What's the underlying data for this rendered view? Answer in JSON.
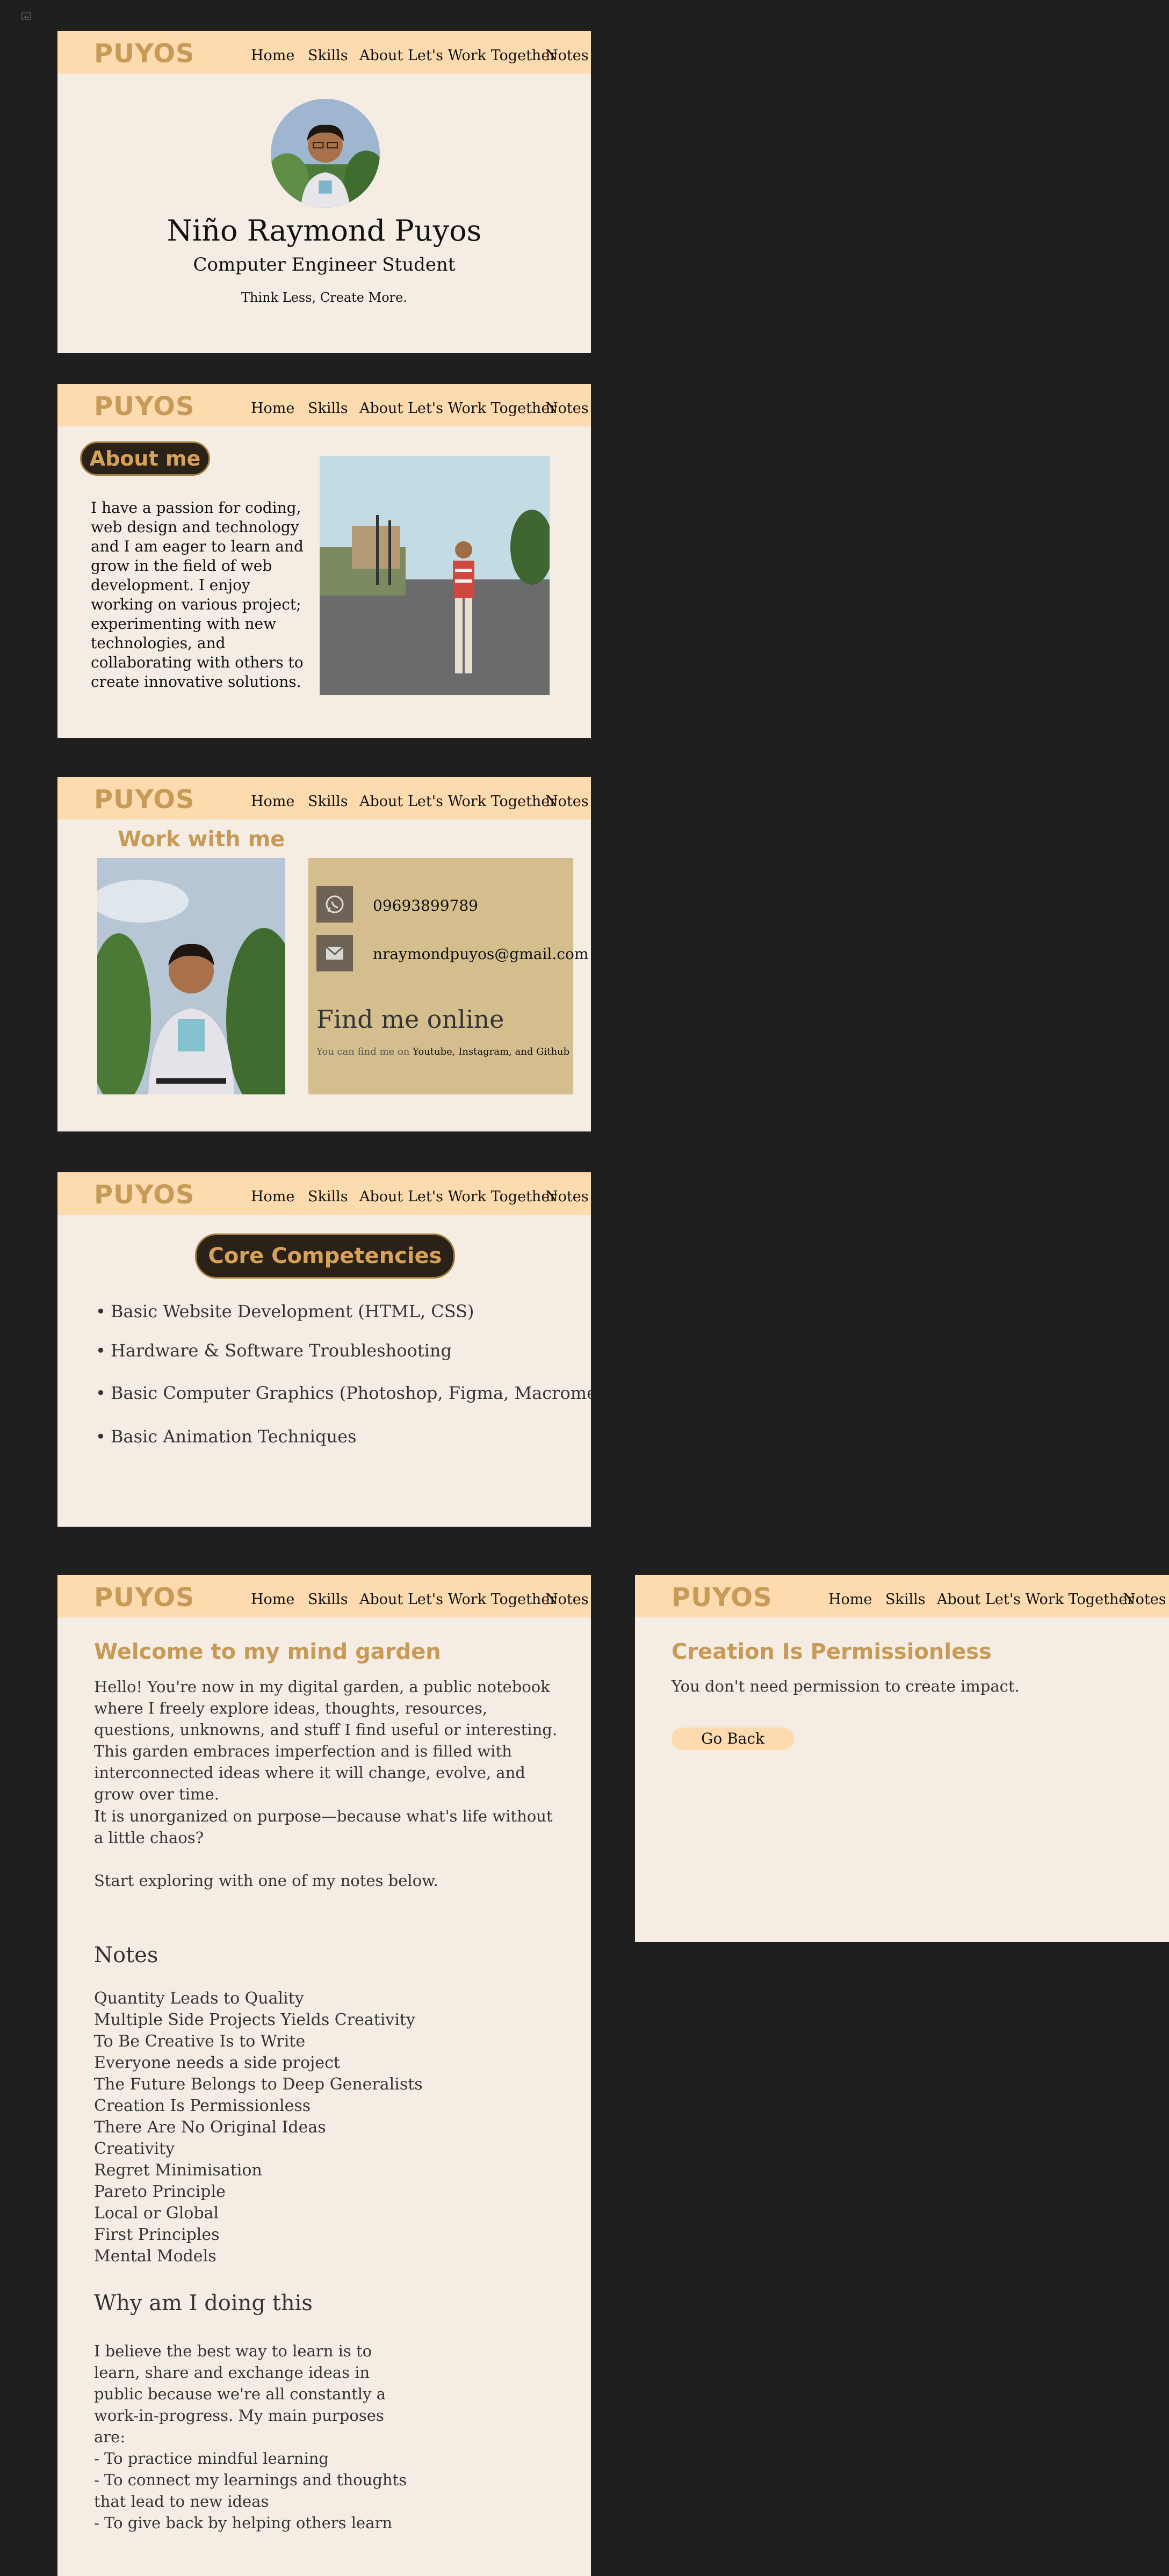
{
  "nav": {
    "logo": "PUYOS",
    "links": [
      "Home",
      "Skills",
      "About",
      "Let's Work Together",
      "Notes"
    ]
  },
  "home": {
    "name": "Niño Raymond Puyos",
    "role": "Computer Engineer Student",
    "tagline": "Think Less, Create More."
  },
  "about": {
    "badge": "About me",
    "text": "I have a passion for coding, web design and technology and I am eager to learn and grow in the field of web development. I enjoy working on various project; experimenting with new technologies, and collaborating with others to create innovative solutions."
  },
  "work": {
    "title": "Work with me",
    "phone": "09693899789",
    "email": "nraymondpuyos@gmail.com",
    "find_title": "Find me online",
    "find_prefix": "You can find me on",
    "find_links": "Youtube, Instagram, and Github"
  },
  "skills": {
    "badge": "Core Competencies",
    "items": [
      "Basic Website Development (HTML, CSS)",
      "Hardware & Software Troubleshooting",
      "Basic Computer Graphics (Photoshop, Figma, Macromedia Flash)",
      "Basic Animation Techniques"
    ]
  },
  "garden": {
    "title": "Welcome to my mind garden",
    "intro1": "Hello! You're now in my digital garden, a public notebook where I freely explore ideas, thoughts, resources, questions, unknowns, and stuff I find useful or interesting. This garden embraces imperfection and is filled with interconnected ideas where it will change, evolve, and grow over time.",
    "intro2": "It is unorganized on purpose—because what's life without a little chaos?",
    "intro3": "Start exploring with one of my notes below.",
    "notes_heading": "Notes",
    "notes": [
      "Quantity Leads to Quality",
      "Multiple Side Projects Yields Creativity",
      "To Be Creative Is to Write",
      "Everyone needs a side project",
      "The Future Belongs to Deep Generalists",
      "Creation Is Permissionless",
      "There Are No Original Ideas",
      "Creativity",
      "Regret Minimisation",
      "Pareto Principle",
      "Local or Global",
      "First Principles",
      "Mental Models"
    ],
    "why_heading": "Why am I doing this",
    "why_text": "I believe the best way to learn is to learn, share and exchange ideas in public because we're all constantly a work-in-progress. My main purposes are:",
    "purposes": [
      "- To practice mindful learning",
      "- To connect my learnings and thoughts that lead to new ideas",
      "- To give back by helping others learn"
    ]
  },
  "note_page": {
    "title": "Creation Is Permissionless",
    "text": "You don't need permission to create impact.",
    "back": "Go Back"
  },
  "colors": {
    "background": "#1f1f1f",
    "panel": "#f5ede4",
    "nav": "#fddbaf",
    "accent_gold": "#c89a57",
    "contact_card": "#d4be8d",
    "dark_pill": "#2a2118"
  },
  "icons": [
    "broken-image-icon",
    "whatsapp-icon",
    "email-icon"
  ]
}
